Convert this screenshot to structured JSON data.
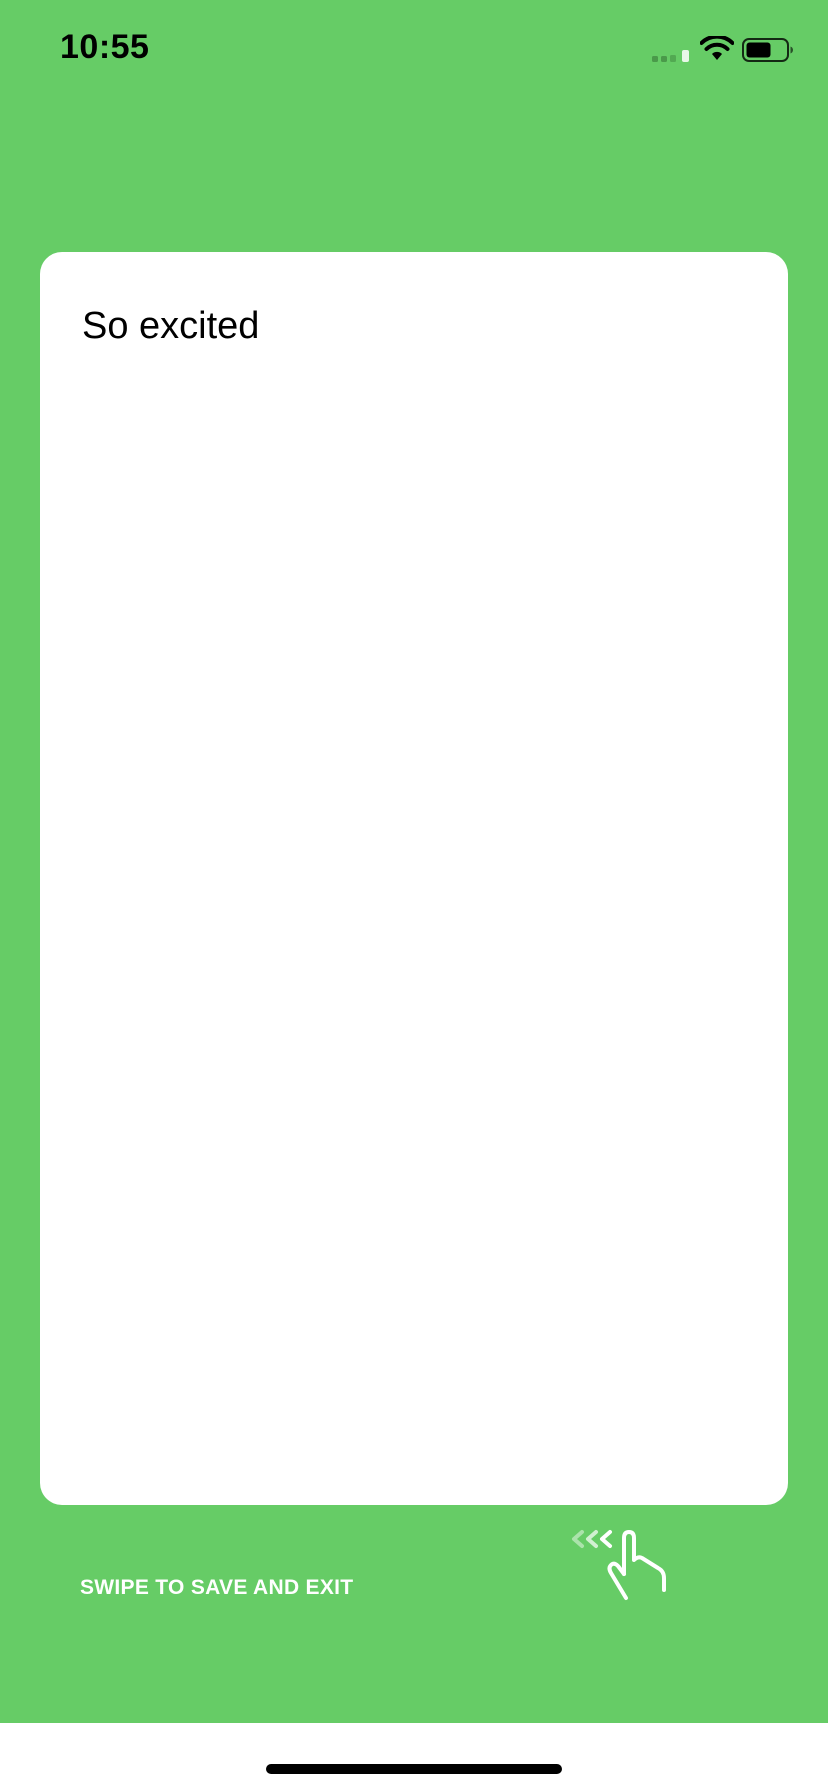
{
  "status_bar": {
    "time": "10:55",
    "icons": [
      "signal-icon",
      "wifi-icon",
      "battery-icon"
    ]
  },
  "note": {
    "text": "So excited"
  },
  "footer": {
    "swipe_label": "SWIPE TO SAVE AND EXIT",
    "gesture_icon": "swipe-left-hand-icon"
  },
  "colors": {
    "background": "#66cc66",
    "card": "#ffffff",
    "text": "#000000",
    "hint_text": "#ffffff"
  }
}
